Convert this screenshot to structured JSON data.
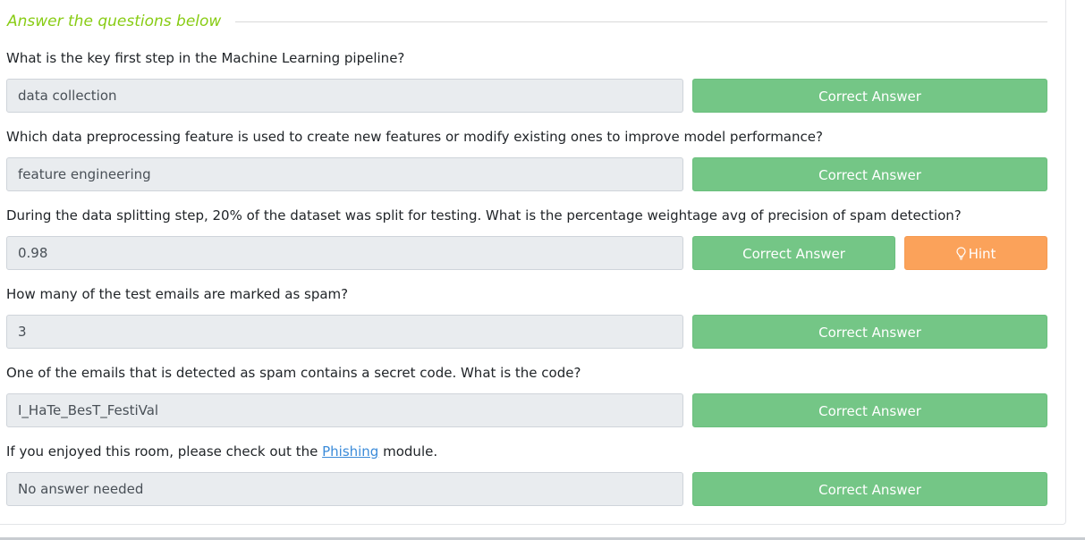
{
  "section": {
    "title": "Answer the questions below"
  },
  "questions": [
    {
      "label": "What is the key first step in the Machine Learning pipeline?",
      "answer": "data collection",
      "button": "Correct Answer"
    },
    {
      "label": "Which data preprocessing feature is used to create new features or modify existing ones to improve model performance?",
      "answer": "feature engineering",
      "button": "Correct Answer"
    },
    {
      "label": "During the data splitting step, 20% of the dataset was split for testing. What is the percentage weightage avg of precision of spam detection?",
      "answer": "0.98",
      "button": "Correct Answer",
      "hint_button": "Hint",
      "hint_icon": "lightbulb-icon"
    },
    {
      "label": "How many of the test emails are marked as spam?",
      "answer": "3",
      "button": "Correct Answer"
    },
    {
      "label": "One of the emails that is detected as spam contains a secret code. What is the code?",
      "answer": "I_HaTe_BesT_FestiVal",
      "button": "Correct Answer"
    },
    {
      "label_before": "If you enjoyed this room, please check out the",
      "label_link": "Phishing",
      "label_after": "module.",
      "answer": "No answer needed",
      "button": "Correct Answer"
    }
  ],
  "colors": {
    "accent_title": "#88cc14",
    "correct": "#74c686",
    "hint": "#fba25a",
    "link": "#3b8bd9",
    "field_bg": "#e9ecef"
  }
}
